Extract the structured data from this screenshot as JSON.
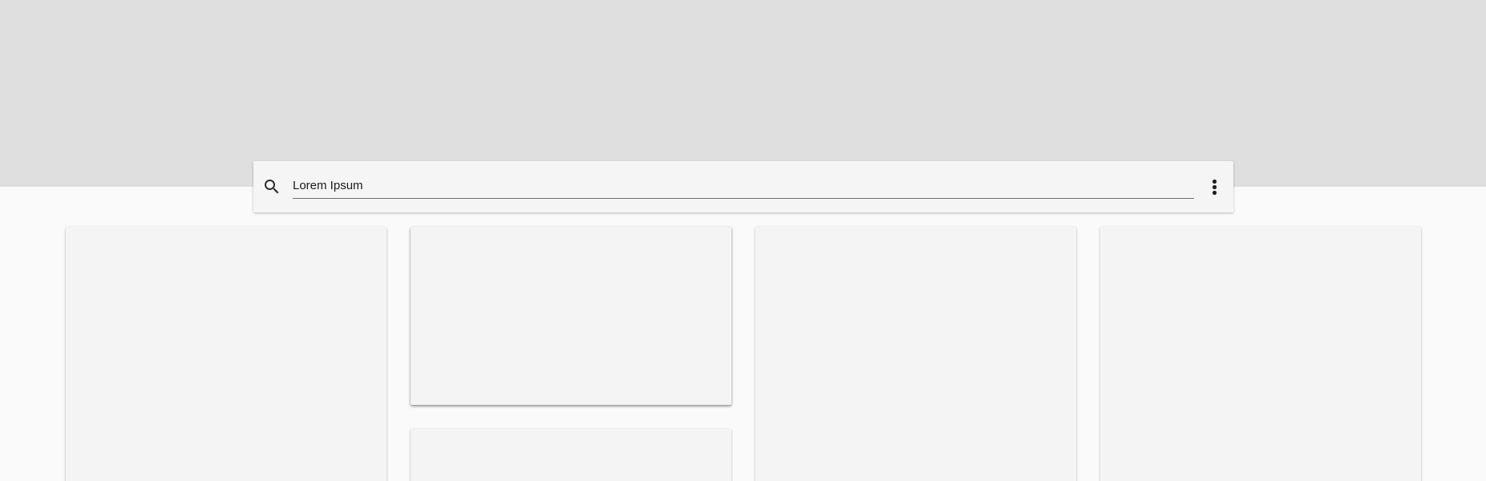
{
  "search": {
    "value": "Lorem Ipsum",
    "icon": "search-icon"
  },
  "toolbar": {
    "more_icon": "more-vertical-icon"
  },
  "colors": {
    "header_band": "#dfdfdf",
    "page_background": "#fafafa",
    "surface": "#f5f5f5"
  },
  "cards": [
    {
      "column": 1,
      "text": ""
    },
    {
      "column": 2,
      "text": ""
    },
    {
      "column": 2,
      "text": ""
    },
    {
      "column": 3,
      "text": ""
    },
    {
      "column": 4,
      "text": ""
    }
  ]
}
